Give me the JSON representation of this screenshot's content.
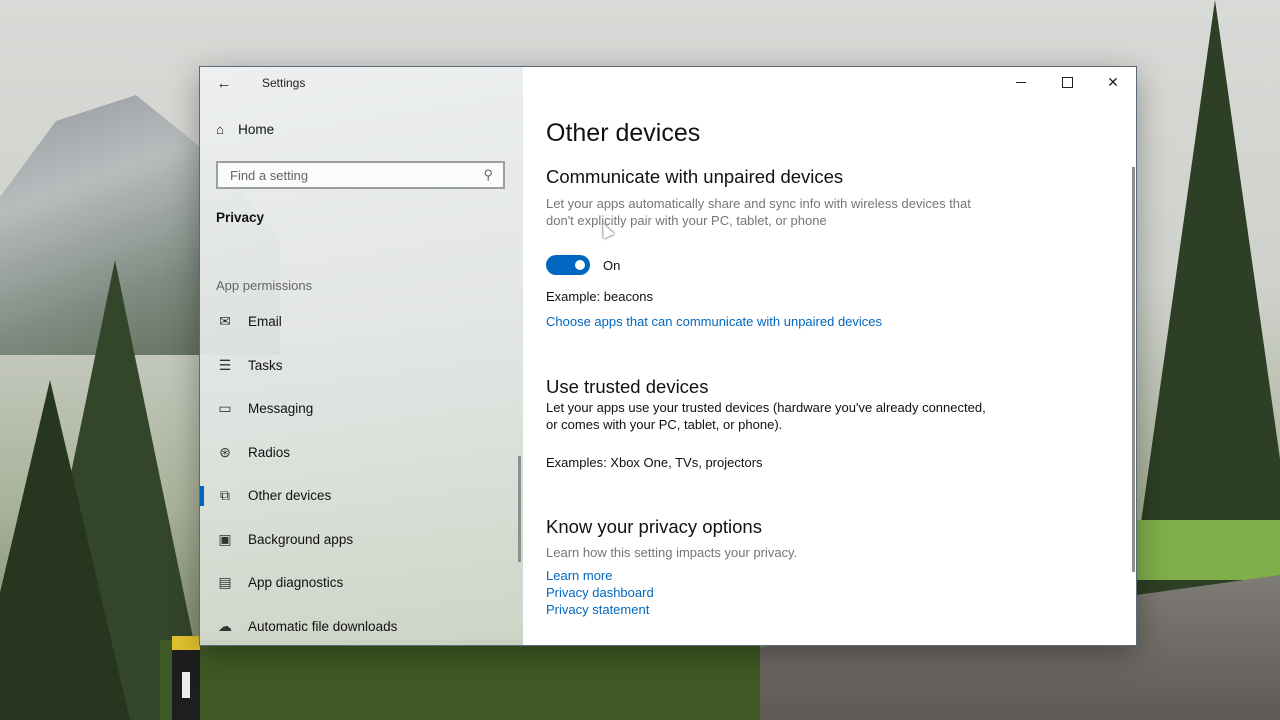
{
  "window": {
    "title": "Settings",
    "controls": {
      "minimize": "minimize",
      "maximize": "maximize",
      "close": "✕"
    }
  },
  "sidebar": {
    "home_label": "Home",
    "search_placeholder": "Find a setting",
    "section_title": "Privacy",
    "group_header": "App permissions",
    "items": [
      {
        "label": "Email",
        "icon": "mail-icon"
      },
      {
        "label": "Tasks",
        "icon": "tasks-icon"
      },
      {
        "label": "Messaging",
        "icon": "messaging-icon"
      },
      {
        "label": "Radios",
        "icon": "radio-antenna-icon"
      },
      {
        "label": "Other devices",
        "icon": "other-devices-icon",
        "active": true
      },
      {
        "label": "Background apps",
        "icon": "background-apps-icon"
      },
      {
        "label": "App diagnostics",
        "icon": "diagnostics-icon"
      },
      {
        "label": "Automatic file downloads",
        "icon": "cloud-icon"
      }
    ]
  },
  "content": {
    "page_title": "Other devices",
    "unpaired": {
      "heading": "Communicate with unpaired devices",
      "description": "Let your apps automatically share and sync info with wireless devices that don't explicitly pair with your PC, tablet, or phone",
      "toggle_state": "On",
      "example": "Example: beacons",
      "link": "Choose apps that can communicate with unpaired devices"
    },
    "trusted": {
      "heading": "Use trusted devices",
      "description": "Let your apps use your trusted devices (hardware you've already connected, or comes with your PC, tablet, or phone).",
      "examples": "Examples: Xbox One, TVs, projectors"
    },
    "privacy": {
      "heading": "Know your privacy options",
      "description": "Learn how this setting impacts your privacy.",
      "links": [
        "Learn more",
        "Privacy dashboard",
        "Privacy statement"
      ]
    }
  },
  "colors": {
    "accent": "#0067c0"
  }
}
